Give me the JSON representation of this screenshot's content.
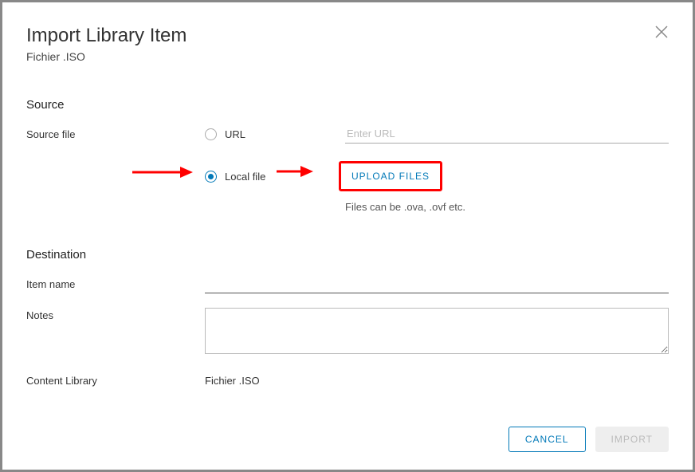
{
  "header": {
    "title": "Import Library Item",
    "subtitle": "Fichier .ISO"
  },
  "source": {
    "heading": "Source",
    "source_file_label": "Source file",
    "url_label": "URL",
    "url_placeholder": "Enter URL",
    "local_file_label": "Local file",
    "upload_button": "UPLOAD FILES",
    "hint": "Files can be .ova, .ovf etc."
  },
  "destination": {
    "heading": "Destination",
    "item_name_label": "Item name",
    "item_name_value": "",
    "notes_label": "Notes",
    "notes_value": "",
    "content_library_label": "Content Library",
    "content_library_value": "Fichier .ISO"
  },
  "footer": {
    "cancel": "CANCEL",
    "import": "IMPORT"
  }
}
